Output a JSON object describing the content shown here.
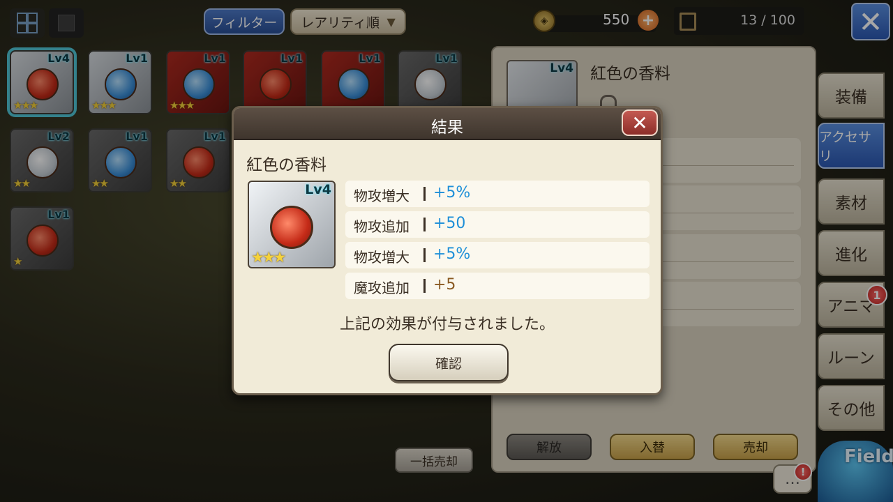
{
  "topbar": {
    "filter_label": "フィルター",
    "sort_label": "レアリティ順",
    "coins": "550",
    "capacity": "13 / 100"
  },
  "items": [
    {
      "lv": "Lv4",
      "stars": "★★★",
      "color": "red",
      "bg": "silver",
      "selected": true
    },
    {
      "lv": "Lv1",
      "stars": "★★★",
      "color": "blue",
      "bg": "silver"
    },
    {
      "lv": "Lv1",
      "stars": "★★★",
      "color": "blue",
      "bg": "red"
    },
    {
      "lv": "Lv1",
      "stars": "",
      "color": "red",
      "bg": "red"
    },
    {
      "lv": "Lv1",
      "stars": "",
      "color": "blue",
      "bg": "red"
    },
    {
      "lv": "Lv1",
      "stars": "",
      "color": "clear",
      "bg": "grey"
    },
    {
      "lv": "Lv2",
      "stars": "★★",
      "color": "clear",
      "bg": "grey"
    },
    {
      "lv": "Lv1",
      "stars": "★★",
      "color": "blue",
      "bg": "grey"
    },
    {
      "lv": "Lv1",
      "stars": "★★",
      "color": "red",
      "bg": "grey"
    },
    {
      "lv": "Lv1",
      "stars": "★",
      "color": "red",
      "bg": "grey"
    }
  ],
  "sell_all_label": "一括売却",
  "right_panel": {
    "item_name": "紅色の香料",
    "item_lv": "Lv4",
    "release_label": "解放",
    "swap_label": "入替",
    "sell_label": "売却"
  },
  "side_tabs": [
    {
      "label": "装備"
    },
    {
      "label": "アクセサリ",
      "active": true
    },
    {
      "label": "素材"
    },
    {
      "label": "進化"
    },
    {
      "label": "アニマ",
      "badge": "1"
    },
    {
      "label": "ルーン"
    },
    {
      "label": "その他"
    }
  ],
  "chat_badge": "!",
  "mascot_text": "Field",
  "modal": {
    "title": "結果",
    "item_name": "紅色の香料",
    "item_lv": "Lv4",
    "item_stars": "★★★",
    "effects": [
      {
        "label": "物攻増大",
        "value": "+5%",
        "color": "#1e8fd8"
      },
      {
        "label": "物攻追加",
        "value": "+50",
        "color": "#1e8fd8"
      },
      {
        "label": "物攻増大",
        "value": "+5%",
        "color": "#1e8fd8"
      },
      {
        "label": "魔攻追加",
        "value": "+5",
        "color": "#8a5a22"
      }
    ],
    "message": "上記の効果が付与されました。",
    "confirm_label": "確認"
  }
}
